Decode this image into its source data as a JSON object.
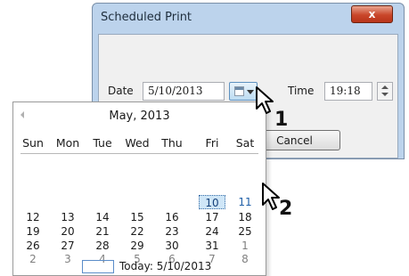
{
  "dialog": {
    "title": "Scheduled Print",
    "close_glyph": "x",
    "date_label": "Date",
    "date_value": "5/10/2013",
    "calendar_button_icon": "calendar-dropdown-icon",
    "time_label": "Time",
    "time_value": "19:18",
    "spinner_icon": "spin-up-down-icon",
    "cancel_label": "Cancel"
  },
  "calendar": {
    "prev_icon": "left-arrow-icon",
    "month_title": "May, 2013",
    "weekdays": [
      "Sun",
      "Mon",
      "Tue",
      "Wed",
      "Thu",
      "Fri",
      "Sat"
    ],
    "weeks": [
      [
        "",
        "",
        "",
        "",
        "",
        "10",
        "11"
      ],
      [
        "12",
        "13",
        "14",
        "15",
        "16",
        "17",
        "18"
      ],
      [
        "19",
        "20",
        "21",
        "22",
        "23",
        "24",
        "25"
      ],
      [
        "26",
        "27",
        "28",
        "29",
        "30",
        "31",
        "1"
      ],
      [
        "2",
        "3",
        "4",
        "5",
        "6",
        "7",
        "8"
      ]
    ],
    "selected_day": "10",
    "highlighted_day": "11",
    "today_text": "Today: 5/10/2013"
  },
  "callouts": [
    "1",
    "2"
  ],
  "colors": {
    "title_bg": "#bcd3ec",
    "close_red": "#c9462a",
    "selected_day_bg": "#cfe6f7"
  }
}
